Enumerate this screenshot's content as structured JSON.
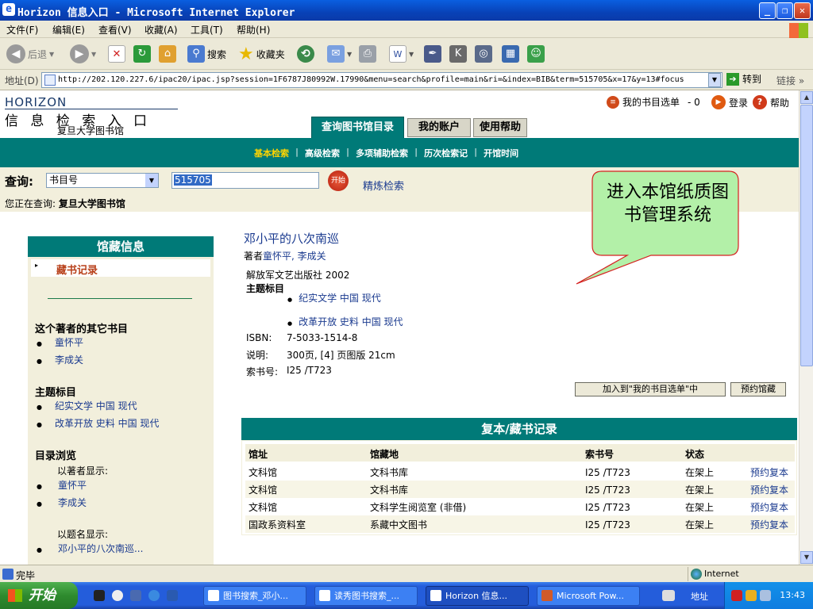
{
  "window": {
    "title": "Horizon 信息入口 - Microsoft Internet Explorer",
    "minimize": "_",
    "restore": "❐",
    "close": "✕"
  },
  "menu": [
    "文件(F)",
    "编辑(E)",
    "查看(V)",
    "收藏(A)",
    "工具(T)",
    "帮助(H)"
  ],
  "toolbar": {
    "back": "后退",
    "search": "搜索",
    "favorites": "收藏夹"
  },
  "address": {
    "label": "地址(D)",
    "url": "http://202.120.227.6/ipac20/ipac.jsp?session=1F6787J80992W.17990&menu=search&profile=main&ri=&index=BIB&term=515705&x=17&y=13#focus",
    "go": "转到",
    "links": "链接"
  },
  "header": {
    "logo": "HORIZON",
    "portal_title": "信 息 检 索 入 口",
    "library_name": "复旦大学图书馆",
    "my_list": "我的书目选单",
    "my_list_count": "- 0",
    "login": "登录",
    "help": "帮助",
    "tabs": [
      "查询图书馆目录",
      "我的账户",
      "使用帮助"
    ],
    "subnav": [
      "基本检索",
      "高级检索",
      "多项辅助检索",
      "历次检索记",
      "开馆时间"
    ]
  },
  "search": {
    "label": "查询:",
    "index": "书目号",
    "term": "515705",
    "go": "开始",
    "refine": "精炼检索",
    "current_prefix": "您正在查询:",
    "current_library": "复旦大学图书馆"
  },
  "callout": "进入本馆纸质图书管理系统",
  "sidebar": {
    "header": "馆藏信息",
    "selected": "藏书记录",
    "author_heading": "这个著者的其它书目",
    "authors": [
      "童怀平",
      "李成关"
    ],
    "subject_heading": "主题标目",
    "subjects": [
      "纪实文学  中国  现代",
      "改革开放  史料  中国  现代"
    ],
    "browse_heading": "目录浏览",
    "by_author_label": "以著者显示:",
    "by_author": [
      "童怀平",
      "李成关"
    ],
    "by_title_label": "以题名显示:",
    "by_title": [
      "邓小平的八次南巡..."
    ]
  },
  "record": {
    "title": "邓小平的八次南巡",
    "author_prefix": "著者",
    "authors": "童怀平, 李成关",
    "publisher": "解放军文艺出版社  2002",
    "subject_label": "主题标目",
    "subjects": [
      "纪实文学  中国  现代",
      "改革开放  史料  中国  现代"
    ],
    "isbn_label": "ISBN:",
    "isbn": "7-5033-1514-8",
    "desc_label": "说明:",
    "desc": "300页, [4] 页图版  21cm",
    "call_label": "索书号:",
    "call_no": "I25 /T723",
    "add_button": "加入到\"我的书目选单\"中",
    "reserve_button": "预约馆藏"
  },
  "holdings": {
    "header": "复本/藏书记录",
    "columns": [
      "馆址",
      "馆藏地",
      "索书号",
      "状态"
    ],
    "rows": [
      {
        "branch": "文科馆",
        "location": "文科书库",
        "call": "I25 /T723",
        "status": "在架上",
        "action": "预约复本"
      },
      {
        "branch": "文科馆",
        "location": "文科书库",
        "call": "I25 /T723",
        "status": "在架上",
        "action": "预约复本"
      },
      {
        "branch": "文科馆",
        "location": "文科学生阅览室 (非借)",
        "call": "I25 /T723",
        "status": "在架上",
        "action": "预约复本"
      },
      {
        "branch": "国政系资料室",
        "location": "系藏中文图书",
        "call": "I25 /T723",
        "status": "在架上",
        "action": "预约复本"
      }
    ]
  },
  "status": {
    "text": "完毕",
    "zone": "Internet"
  },
  "taskbar": {
    "start": "开始",
    "items": [
      "图书搜索_邓小...",
      "读秀图书搜索_...",
      "Horizon 信息...",
      "Microsoft Pow..."
    ],
    "address": "地址",
    "clock": "13:43"
  }
}
